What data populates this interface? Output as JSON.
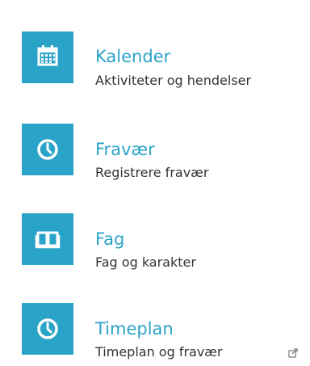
{
  "menu": {
    "items": [
      {
        "title": "Kalender",
        "subtitle": "Aktiviteter og hendelser",
        "icon": "calendar-icon"
      },
      {
        "title": "Fravær",
        "subtitle": "Registrere fravær",
        "icon": "clock-icon"
      },
      {
        "title": "Fag",
        "subtitle": "Fag og karakter",
        "icon": "book-icon"
      },
      {
        "title": "Timeplan",
        "subtitle": "Timeplan og fravær",
        "icon": "clock-icon",
        "external_icon": "external-link-icon"
      }
    ]
  },
  "colors": {
    "accent": "#2aa3c8",
    "subtitle": "#333333",
    "icon_glyph": "#ffffff"
  }
}
